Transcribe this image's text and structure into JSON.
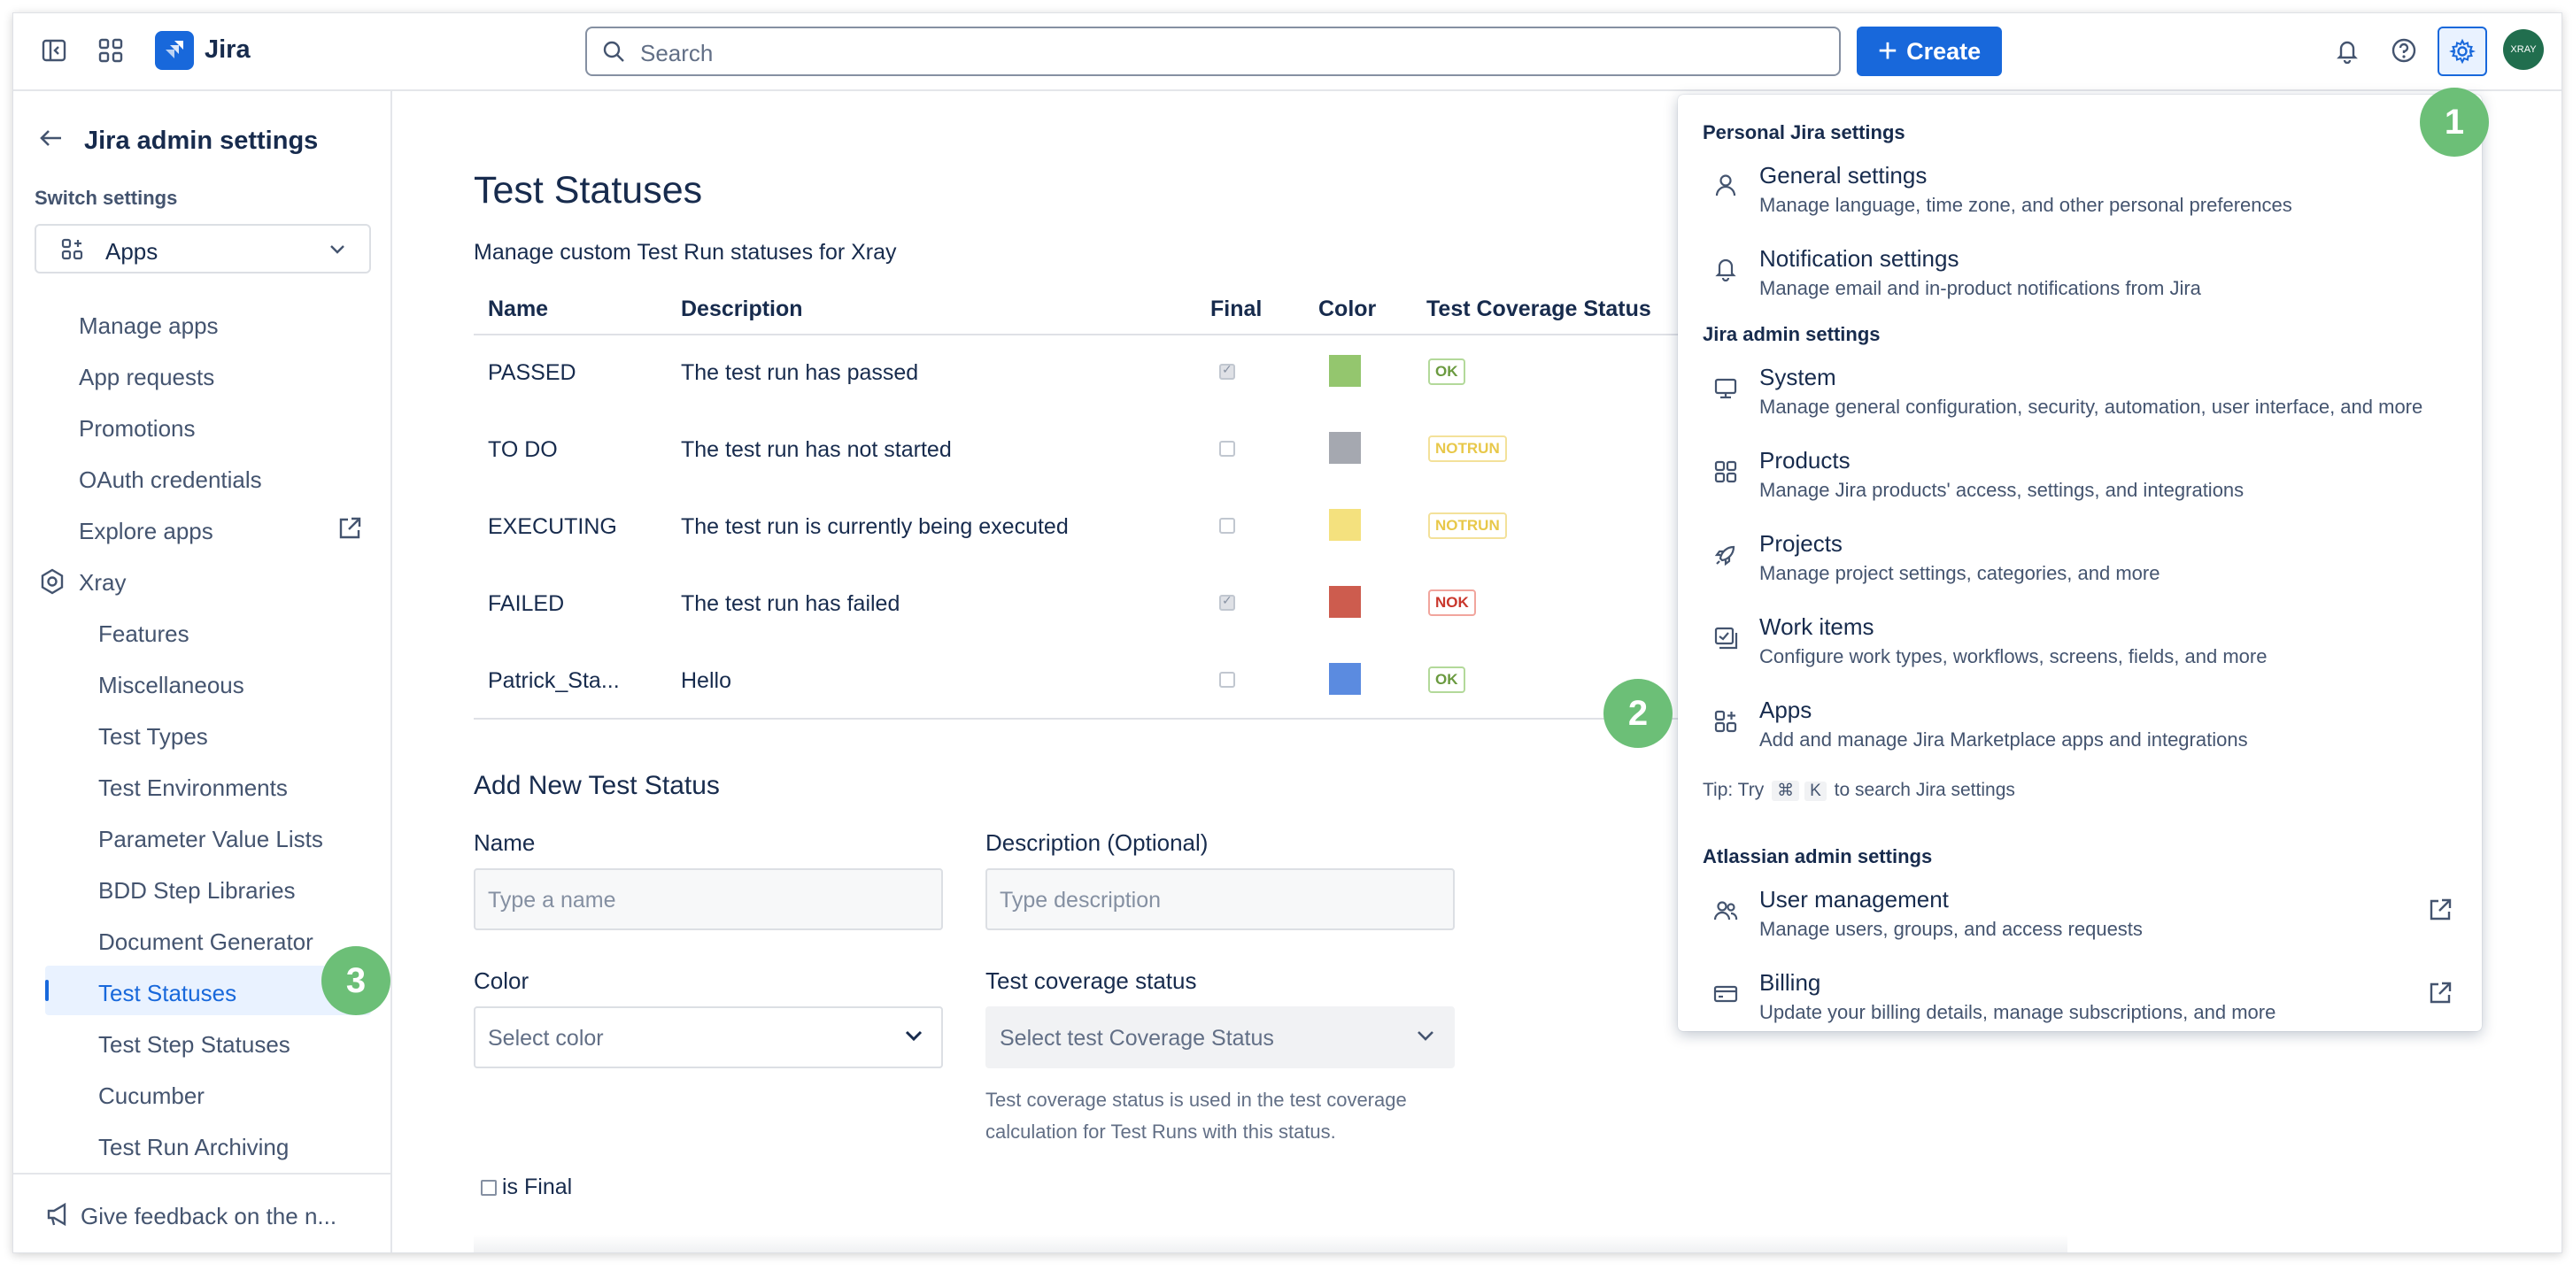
{
  "topbar": {
    "app_name": "Jira",
    "search_placeholder": "Search",
    "create_label": "Create",
    "avatar_text": "XRAY"
  },
  "sidebar": {
    "title": "Jira admin settings",
    "switch_label": "Switch settings",
    "switch_value": "Apps",
    "items": [
      {
        "label": "Manage apps"
      },
      {
        "label": "App requests"
      },
      {
        "label": "Promotions"
      },
      {
        "label": "OAuth credentials"
      },
      {
        "label": "Explore apps"
      },
      {
        "label": "Xray"
      },
      {
        "label": "Features"
      },
      {
        "label": "Miscellaneous"
      },
      {
        "label": "Test Types"
      },
      {
        "label": "Test Environments"
      },
      {
        "label": "Parameter Value Lists"
      },
      {
        "label": "BDD Step Libraries"
      },
      {
        "label": "Document Generator"
      },
      {
        "label": "Test Statuses"
      },
      {
        "label": "Test Step Statuses"
      },
      {
        "label": "Cucumber"
      },
      {
        "label": "Test Run Archiving"
      }
    ],
    "feedback": "Give feedback on the n..."
  },
  "main": {
    "title": "Test Statuses",
    "subtitle": "Manage custom Test Run statuses for Xray",
    "columns": [
      "Name",
      "Description",
      "Final",
      "Color",
      "Test Coverage Status"
    ],
    "rows": [
      {
        "name": "PASSED",
        "description": "The test run has passed",
        "final": true,
        "color": "#94c66e",
        "coverage": "OK"
      },
      {
        "name": "TO DO",
        "description": "The test run has not started",
        "final": false,
        "color": "#a5a8b0",
        "coverage": "NOTRUN"
      },
      {
        "name": "EXECUTING",
        "description": "The test run is currently being executed",
        "final": false,
        "color": "#f4e17e",
        "coverage": "NOTRUN"
      },
      {
        "name": "FAILED",
        "description": "The test run has failed",
        "final": true,
        "color": "#cd5c4e",
        "coverage": "NOK"
      },
      {
        "name": "Patrick_Sta...",
        "description": "Hello",
        "final": false,
        "color": "#5b8be0",
        "coverage": "OK"
      }
    ],
    "form": {
      "title": "Add New Test Status",
      "name_label": "Name",
      "name_placeholder": "Type a name",
      "desc_label": "Description (Optional)",
      "desc_placeholder": "Type description",
      "color_label": "Color",
      "color_placeholder": "Select color",
      "coverage_label": "Test coverage status",
      "coverage_placeholder": "Select test Coverage Status",
      "coverage_help": "Test coverage status is used in the test coverage calculation for Test Runs with this status.",
      "is_final_label": "is Final"
    }
  },
  "dropdown": {
    "personal_section": "Personal Jira settings",
    "admin_section": "Jira admin settings",
    "atlassian_section": "Atlassian admin settings",
    "items": [
      {
        "title": "General settings",
        "desc": "Manage language, time zone, and other personal preferences"
      },
      {
        "title": "Notification settings",
        "desc": "Manage email and in-product notifications from Jira"
      },
      {
        "title": "System",
        "desc": "Manage general configuration, security, automation, user interface, and more"
      },
      {
        "title": "Products",
        "desc": "Manage Jira products' access, settings, and integrations"
      },
      {
        "title": "Projects",
        "desc": "Manage project settings, categories, and more"
      },
      {
        "title": "Work items",
        "desc": "Configure work types, workflows, screens, fields, and more"
      },
      {
        "title": "Apps",
        "desc": "Add and manage Jira Marketplace apps and integrations"
      },
      {
        "title": "User management",
        "desc": "Manage users, groups, and access requests"
      },
      {
        "title": "Billing",
        "desc": "Update your billing details, manage subscriptions, and more"
      }
    ],
    "tip_prefix": "Tip: Try",
    "tip_key1": "⌘",
    "tip_key2": "K",
    "tip_suffix": "to search Jira settings"
  },
  "badges": [
    "1",
    "2",
    "3"
  ],
  "colors": {
    "brand": "#1868db",
    "badge": "#6cbf77",
    "active_bg": "#e9f2ff"
  }
}
